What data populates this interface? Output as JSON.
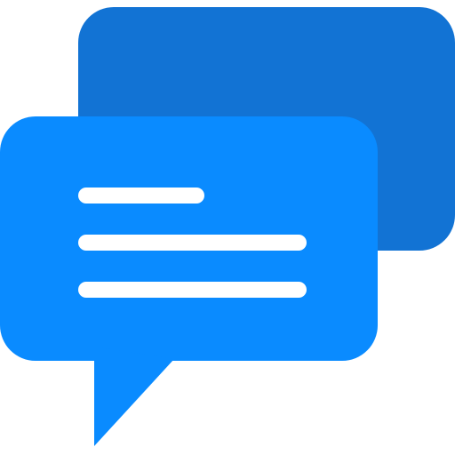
{
  "icon": {
    "name": "chat-bubbles-icon",
    "colors": {
      "back_bubble": "#1273D4",
      "front_bubble": "#0A8BFF",
      "text_lines": "#FFFFFF",
      "background": "#FFFFFF"
    }
  }
}
